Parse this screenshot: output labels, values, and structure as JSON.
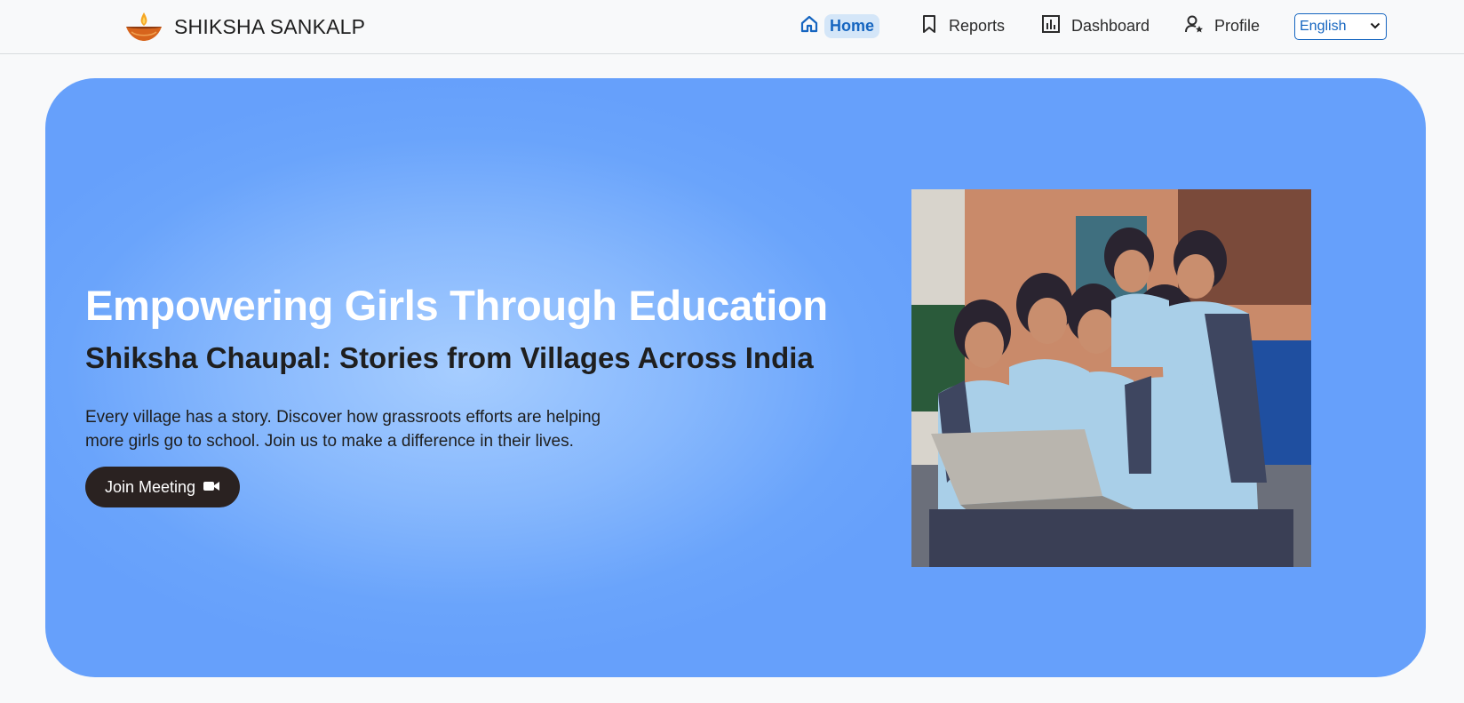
{
  "brand": {
    "name": "SHIKSHA SANKALP",
    "logo_icon": "diya-lamp-icon"
  },
  "nav": {
    "items": [
      {
        "label": "Home",
        "icon": "home-icon",
        "active": true
      },
      {
        "label": "Reports",
        "icon": "bookmark-icon",
        "active": false
      },
      {
        "label": "Dashboard",
        "icon": "bar-chart-icon",
        "active": false
      },
      {
        "label": "Profile",
        "icon": "user-star-icon",
        "active": false
      }
    ],
    "language": {
      "selected": "English"
    }
  },
  "hero": {
    "title": "Empowering Girls Through Education",
    "subtitle": "Shiksha Chaupal: Stories from Villages Across India",
    "description_line1": "Every village has a story. Discover how grassroots efforts are helping",
    "description_line2": "more girls go to school. Join us to make a difference in their lives.",
    "button_label": "Join Meeting",
    "button_icon": "video-camera-icon",
    "image_subject": "schoolgirls-with-laptop-photo"
  },
  "colors": {
    "accent": "#1565c0",
    "hero_bg": "#66a0fb",
    "button_bg": "#2a2221",
    "active_pill": "#d4e6f8"
  }
}
